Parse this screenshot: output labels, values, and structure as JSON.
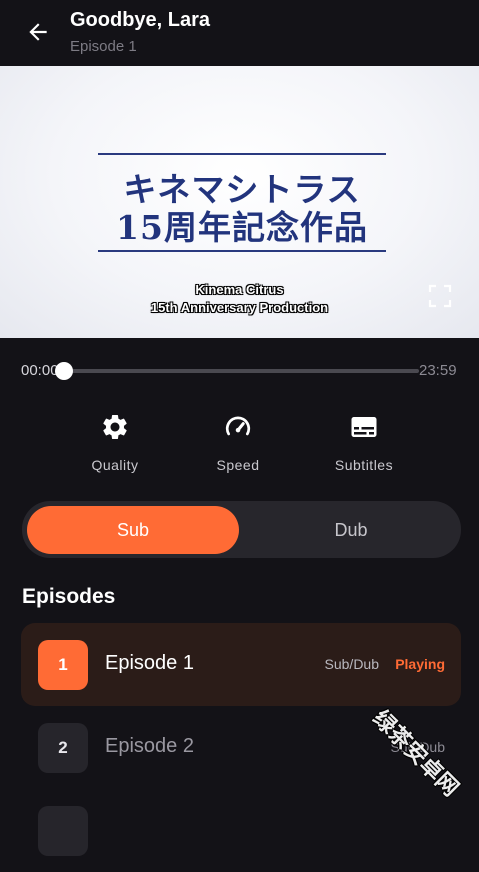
{
  "header": {
    "title": "Goodbye, Lara",
    "subtitle": "Episode 1"
  },
  "video": {
    "jp_line1": "キネマシトラス",
    "jp_line2": "15周年記念作品",
    "caption_line1": "Kinema Citrus",
    "caption_line2": "15th Anniversary Production"
  },
  "progress": {
    "current_time": "00:00",
    "total_time": "23:59",
    "fraction": 0.0
  },
  "controls": [
    {
      "label": "Quality",
      "icon": "gear-icon"
    },
    {
      "label": "Speed",
      "icon": "speedometer-icon"
    },
    {
      "label": "Subtitles",
      "icon": "subtitles-icon"
    }
  ],
  "audio_toggle": {
    "sub_label": "Sub",
    "dub_label": "Dub",
    "selected": "Sub"
  },
  "episodes_section": {
    "title": "Episodes",
    "items": [
      {
        "number": "1",
        "title": "Episode 1",
        "type": "Sub/Dub",
        "status": "Playing"
      },
      {
        "number": "2",
        "title": "Episode 2",
        "type": "Sub/Dub",
        "status": ""
      }
    ]
  },
  "watermark": "绿茶安卓网",
  "colors": {
    "accent": "#ff6b35",
    "background": "#131217",
    "active_row": "#2b1c18"
  }
}
